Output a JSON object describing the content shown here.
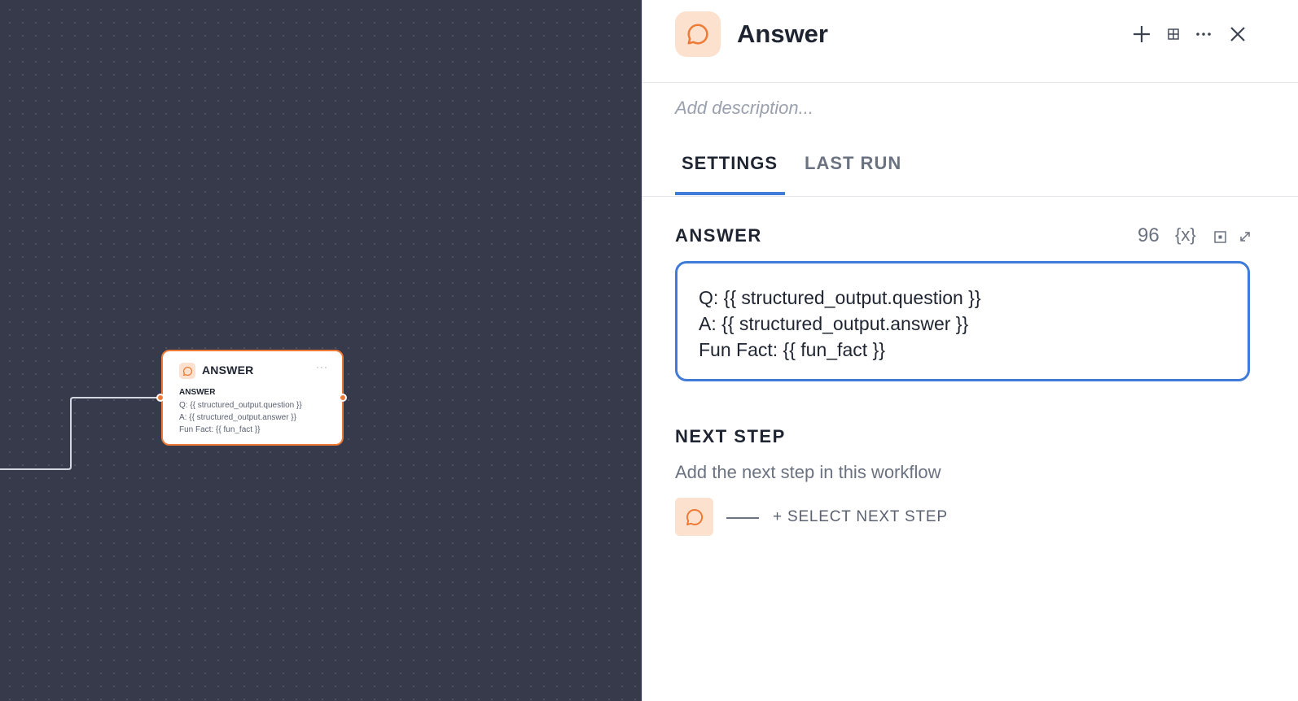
{
  "canvas": {
    "node": {
      "title": "ANSWER",
      "more": "···",
      "label": "ANSWER",
      "lines": [
        "Q: {{ structured_output.question }}",
        "A: {{ structured_output.answer }}",
        "Fun Fact: {{ fun_fact }}"
      ]
    }
  },
  "panel": {
    "title": "Answer",
    "icon": "chat-bubble-icon",
    "accent": "#ee7a36",
    "description_placeholder": "Add description...",
    "tabs": [
      {
        "label": "SETTINGS",
        "active": true
      },
      {
        "label": "LAST RUN",
        "active": false
      }
    ],
    "answer": {
      "title": "ANSWER",
      "char_count": "96",
      "variable_button": "{x}",
      "content": "Q: {{ structured_output.question }}\nA: {{ structured_output.answer }}\nFun Fact: {{ fun_fact }}"
    },
    "next_step": {
      "title": "NEXT STEP",
      "description": "Add the next step in this workflow",
      "select_label": "+ SELECT NEXT STEP"
    }
  },
  "colors": {
    "canvas_bg": "#373a4b",
    "accent_orange": "#ee7a36",
    "accent_blue": "#3f7bd9",
    "icon_bg": "#fde1cf"
  }
}
